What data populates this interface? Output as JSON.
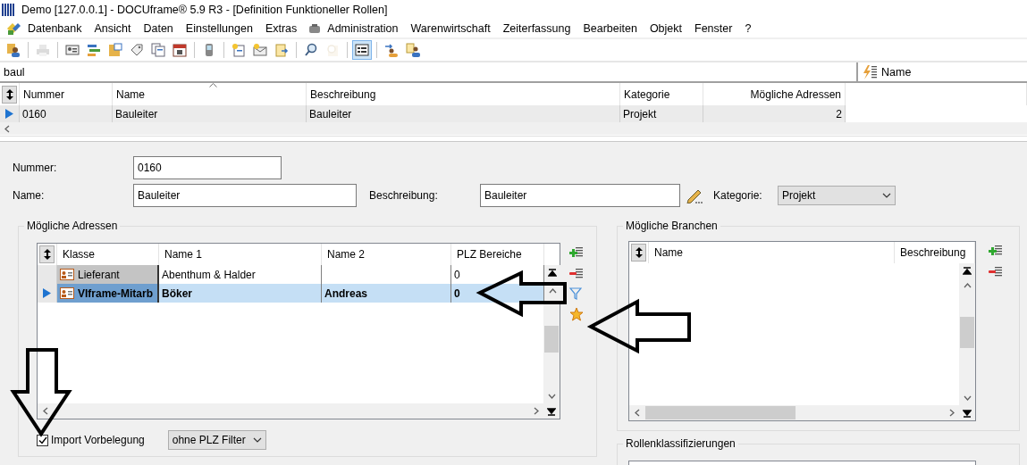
{
  "window": {
    "title": "Demo [127.0.0.1] - DOCUframe® 5.9 R3 - [Definition Funktioneller Rollen]"
  },
  "menu": [
    {
      "label": "Datenbank",
      "icon": false
    },
    {
      "label": "Ansicht",
      "icon": false
    },
    {
      "label": "Daten",
      "icon": false
    },
    {
      "label": "Einstellungen",
      "icon": false
    },
    {
      "label": "Extras",
      "icon": false
    },
    {
      "label": "Administration",
      "icon": true
    },
    {
      "label": "Warenwirtschaft",
      "icon": false
    },
    {
      "label": "Zeiterfassung",
      "icon": false
    },
    {
      "label": "Bearbeiten",
      "icon": false
    },
    {
      "label": "Objekt",
      "icon": false
    },
    {
      "label": "Fenster",
      "icon": false
    },
    {
      "label": "?",
      "icon": false
    }
  ],
  "toolbar": [
    [
      {
        "kind": "people",
        "disabled": false,
        "selected": false
      }
    ],
    [
      {
        "kind": "printer",
        "disabled": true,
        "selected": false
      }
    ],
    [
      {
        "kind": "card",
        "disabled": false,
        "selected": false
      },
      {
        "kind": "bars",
        "disabled": false,
        "selected": false
      },
      {
        "kind": "folder",
        "disabled": false,
        "selected": false
      },
      {
        "kind": "tag",
        "disabled": false,
        "selected": false
      },
      {
        "kind": "documents",
        "disabled": false,
        "selected": false
      },
      {
        "kind": "calendar",
        "disabled": false,
        "selected": false
      }
    ],
    [
      {
        "kind": "phone",
        "disabled": false,
        "selected": false
      }
    ],
    [
      {
        "kind": "new-document",
        "disabled": false,
        "selected": false
      },
      {
        "kind": "envelope",
        "disabled": false,
        "selected": false
      },
      {
        "kind": "export",
        "disabled": false,
        "selected": false
      }
    ],
    [
      {
        "kind": "search",
        "disabled": false,
        "selected": false
      },
      {
        "kind": "magnifier",
        "disabled": true,
        "selected": false
      }
    ],
    [
      {
        "kind": "layout",
        "disabled": false,
        "selected": true
      }
    ],
    [
      {
        "kind": "people-arrow",
        "disabled": false,
        "selected": false
      },
      {
        "kind": "people-document",
        "disabled": false,
        "selected": false
      }
    ]
  ],
  "search": {
    "value": "baul"
  },
  "search_mode": {
    "label": "Name"
  },
  "table": {
    "columns": [
      {
        "label": "Nummer",
        "sorted": false,
        "numeric": false
      },
      {
        "label": "Name",
        "sorted": true,
        "numeric": false
      },
      {
        "label": "Beschreibung",
        "sorted": false,
        "numeric": false
      },
      {
        "label": "Kategorie",
        "sorted": false,
        "numeric": false
      },
      {
        "label": "Mögliche Adressen",
        "sorted": false,
        "numeric": true
      }
    ],
    "rows": [
      {
        "selected": true,
        "cells": [
          "0160",
          "Bauleiter",
          "Bauleiter",
          "Projekt",
          "2"
        ]
      }
    ]
  },
  "form": {
    "nummer": {
      "label": "Nummer:",
      "value": "0160"
    },
    "name": {
      "label": "Name:",
      "value": "Bauleiter"
    },
    "beschreibung": {
      "label": "Beschreibung:",
      "value": "Bauleiter"
    },
    "kategorie": {
      "label": "Kategorie:",
      "value": "Projekt"
    }
  },
  "adressen": {
    "title": "Mögliche Adressen",
    "columns": [
      "Klasse",
      "Name 1",
      "Name 2",
      "PLZ Bereiche"
    ],
    "rows": [
      {
        "selected": false,
        "cells": [
          "Lieferant",
          "Abenthum & Halder",
          "",
          "0"
        ]
      },
      {
        "selected": true,
        "cells": [
          "VIframe-Mitarb",
          "Böker",
          "Andreas",
          "0"
        ]
      }
    ],
    "import": {
      "label": "Import Vorbelegung",
      "checked": true
    },
    "filter": {
      "value": "ohne PLZ Filter"
    }
  },
  "branchen": {
    "title": "Mögliche Branchen",
    "columns": [
      "Name",
      "Beschreibung"
    ]
  },
  "klassifizierungen": {
    "title": "Rollenklassifizierungen"
  }
}
